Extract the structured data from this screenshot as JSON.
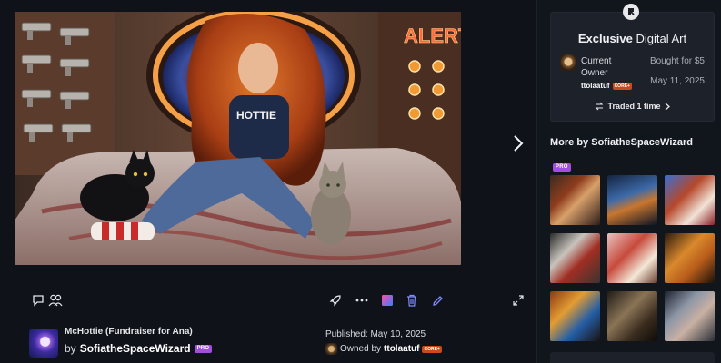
{
  "viewer": {
    "artwork_alt": "Digital art of a red-haired woman with two cats in a spaceship cabin",
    "poster_text_alert": "ALERT",
    "shirt_text": "HOTTIE",
    "actions": {
      "comment": "comment-icon",
      "collaborators": "people-icon",
      "boost": "rocket-icon",
      "more": "more-icon",
      "color": "color-swatch-icon",
      "delete": "trash-icon",
      "edit": "pencil-icon",
      "expand": "expand-icon"
    }
  },
  "meta": {
    "title": "McHottie (Fundraiser for Ana)",
    "by_prefix": "by",
    "creator": "SofiatheSpaceWizard",
    "creator_badge": "PRO",
    "published": "Published: May 10, 2025",
    "owned_prefix": "Owned by",
    "owner": "ttolaatuf",
    "owner_badge": "CORE+"
  },
  "side": {
    "card": {
      "title_bold": "Exclusive",
      "title_rest": "Digital Art",
      "current_owner_label": "Current Owner",
      "owner_name": "ttolaatuf",
      "owner_badge": "CORE+",
      "bought": "Bought for $5",
      "date": "May 11, 2025",
      "traded": "Traded 1 time"
    },
    "more_title": "More by SofiatheSpaceWizard",
    "more_badge": "PRO"
  },
  "colors": {
    "background": "#0f1219",
    "panel": "#1c212a",
    "pro_badge": "#a14fe0",
    "core_badge": "#c94a1c",
    "accent_edit": "#6e7cff"
  }
}
